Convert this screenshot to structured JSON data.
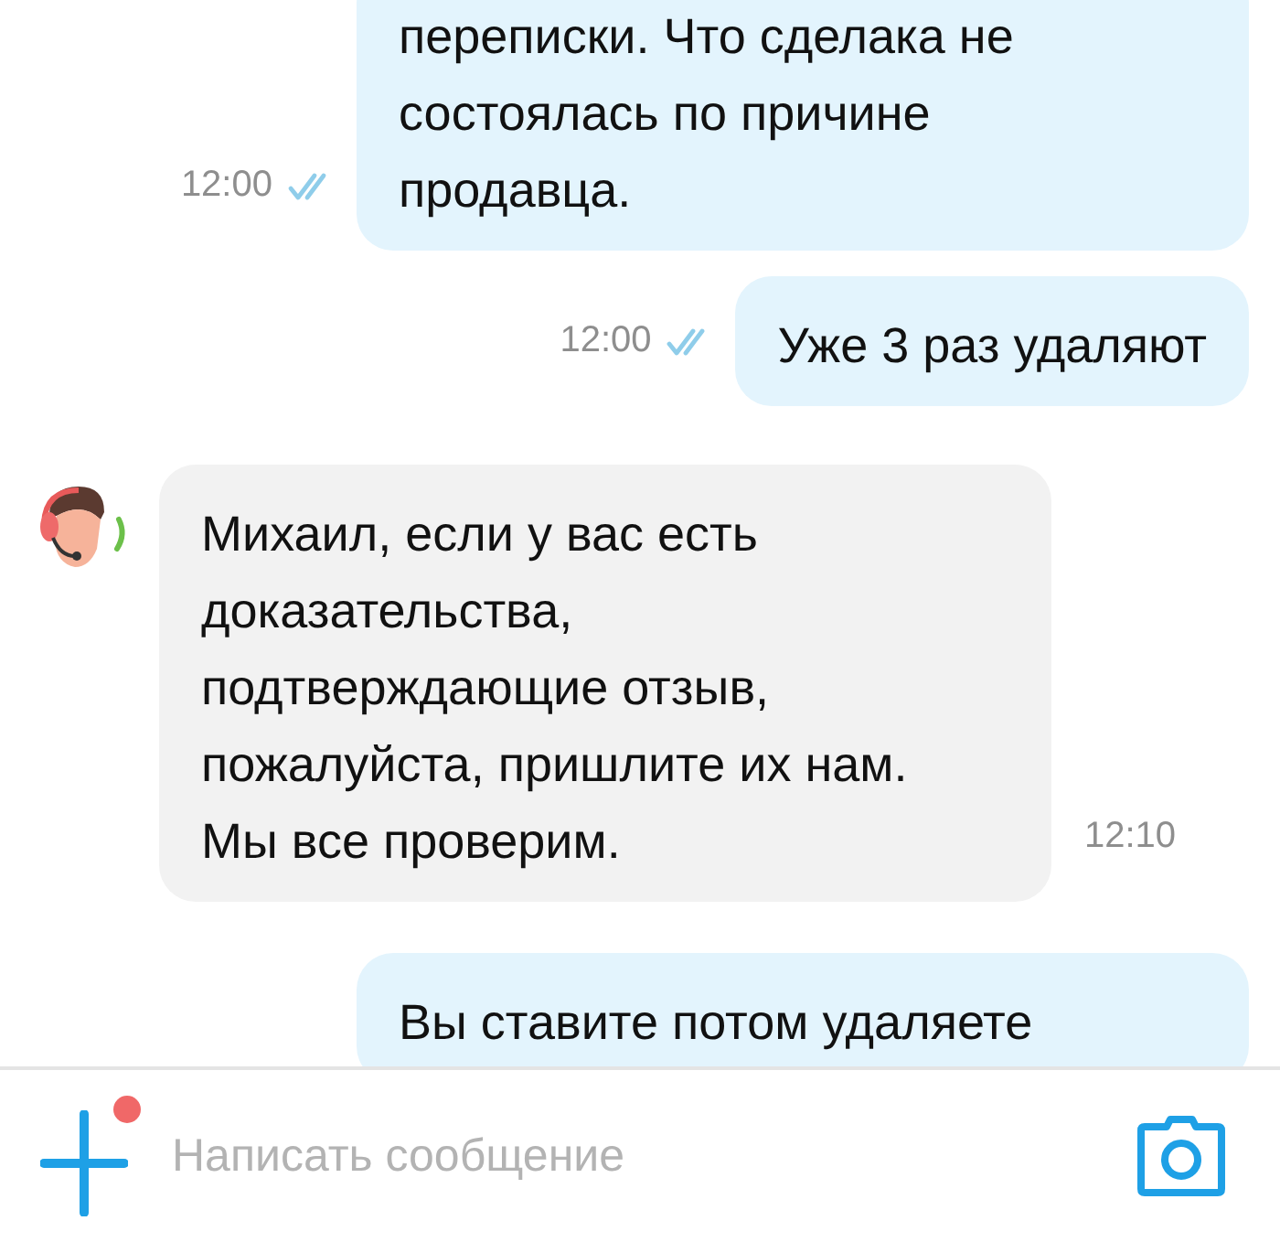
{
  "messages": [
    {
      "kind": "outgoing",
      "lines": [
        "переписки. Что сделака не",
        "состоялась по причине",
        "продавца."
      ],
      "time": "12:00",
      "read": true
    },
    {
      "kind": "outgoing",
      "lines": [
        "Уже 3 раз удаляют"
      ],
      "time": "12:00",
      "read": true
    },
    {
      "kind": "incoming",
      "lines": [
        "Михаил, если у вас есть",
        "доказательства,",
        "подтверждающие отзыв,",
        "пожалуйста, пришлите их нам.",
        "Мы все проверим."
      ],
      "time": "12:10"
    },
    {
      "kind": "outgoing",
      "lines": [
        "Вы ставите потом удаляете"
      ]
    }
  ],
  "composer": {
    "placeholder": "Написать сообщение",
    "attach_badge": true
  }
}
